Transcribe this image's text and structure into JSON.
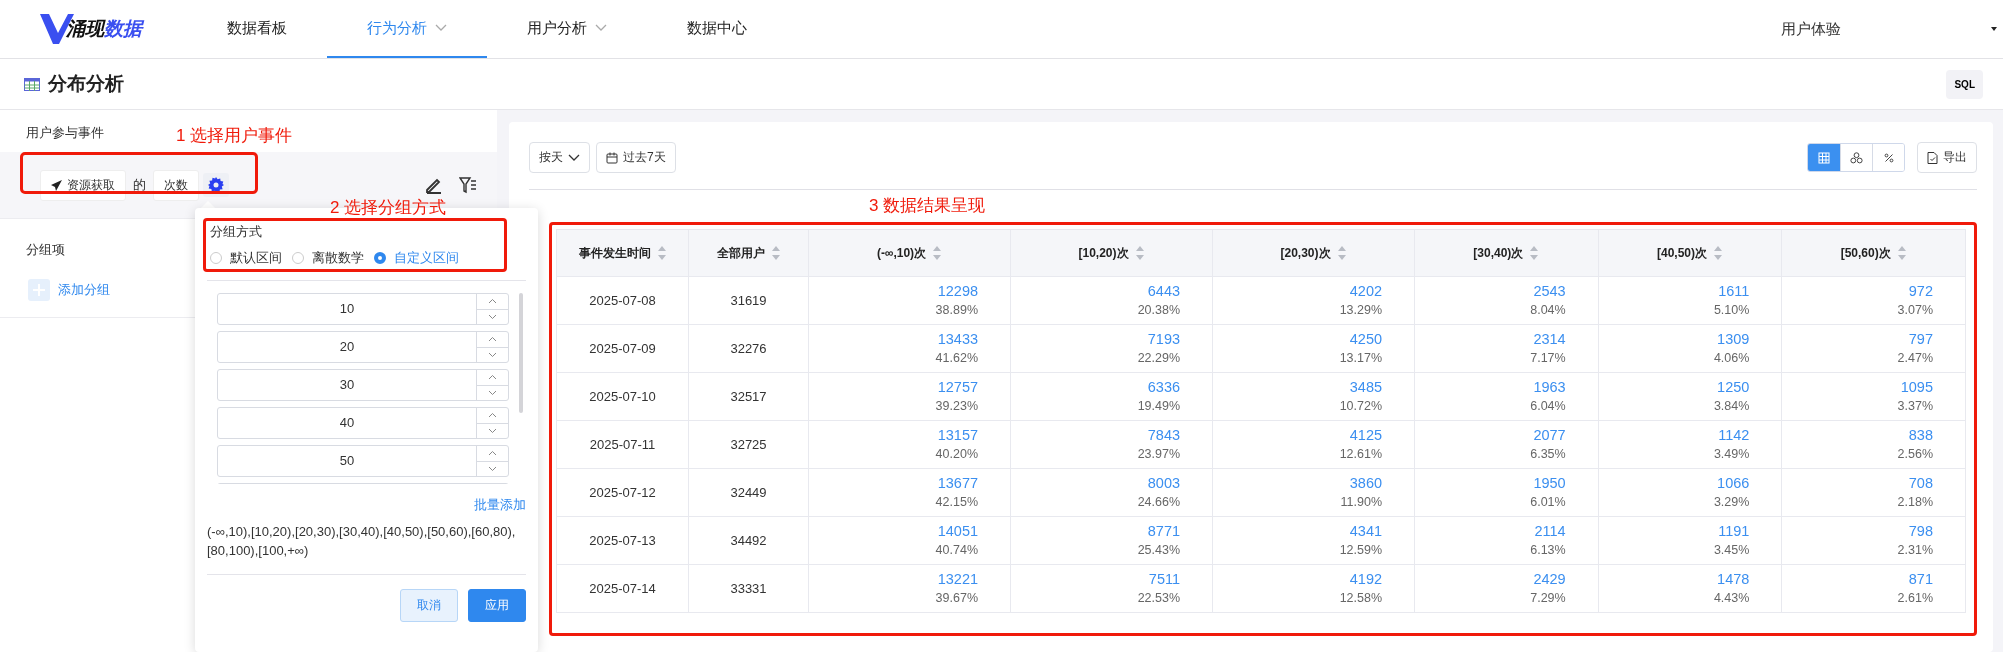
{
  "logo": {
    "parts": [
      "涌现",
      "数据"
    ]
  },
  "nav": [
    {
      "label": "数据看板",
      "selected": false,
      "dropdown": false
    },
    {
      "label": "行为分析",
      "selected": true,
      "dropdown": true
    },
    {
      "label": "用户分析",
      "selected": false,
      "dropdown": true
    },
    {
      "label": "数据中心",
      "selected": false,
      "dropdown": false
    }
  ],
  "user_menu": "用户体验",
  "page_title": "分布分析",
  "sql_button": "SQL",
  "left_panel": {
    "event_label": "用户参与事件",
    "event": {
      "name": "资源获取",
      "connector": "的",
      "metric": "次数"
    },
    "group_label": "分组项",
    "add_group": "添加分组"
  },
  "popover": {
    "title": "分组方式",
    "options": [
      {
        "label": "默认区间",
        "selected": false
      },
      {
        "label": "离散数学",
        "selected": false
      },
      {
        "label": "自定义区间",
        "selected": true
      }
    ],
    "inputs": [
      "10",
      "20",
      "30",
      "40",
      "50"
    ],
    "batch_add": "批量添加",
    "ranges": "(-∞,10),[10,20),[20,30),[30,40),[40,50),[50,60),[60,80),[80,100),[100,+∞)",
    "buttons": [
      {
        "label": "取消",
        "kind": "secondary"
      },
      {
        "label": "应用",
        "kind": "primary"
      }
    ]
  },
  "annotations": [
    "1 选择用户事件",
    "2 选择分组方式",
    "3 数据结果呈现"
  ],
  "toolbar": {
    "granularity": "按天",
    "date_range": "过去7天",
    "views": [
      {
        "kind": "table",
        "selected": true
      },
      {
        "kind": "chart",
        "selected": false
      },
      {
        "kind": "percent",
        "selected": false
      }
    ],
    "export": "导出"
  },
  "table": {
    "columns": [
      "事件发生时间",
      "全部用户",
      "(-∞,10)次",
      "[10,20)次",
      "[20,30)次",
      "[30,40)次",
      "[40,50)次",
      "[50,60)次"
    ],
    "rows": [
      [
        {
          "value": "2025-07-08"
        },
        {
          "value": "31619"
        },
        {
          "value": "12298",
          "share": "38.89%"
        },
        {
          "value": "6443",
          "share": "20.38%"
        },
        {
          "value": "4202",
          "share": "13.29%"
        },
        {
          "value": "2543",
          "share": "8.04%"
        },
        {
          "value": "1611",
          "share": "5.10%"
        },
        {
          "value": "972",
          "share": "3.07%"
        }
      ],
      [
        {
          "value": "2025-07-09"
        },
        {
          "value": "32276"
        },
        {
          "value": "13433",
          "share": "41.62%"
        },
        {
          "value": "7193",
          "share": "22.29%"
        },
        {
          "value": "4250",
          "share": "13.17%"
        },
        {
          "value": "2314",
          "share": "7.17%"
        },
        {
          "value": "1309",
          "share": "4.06%"
        },
        {
          "value": "797",
          "share": "2.47%"
        }
      ],
      [
        {
          "value": "2025-07-10"
        },
        {
          "value": "32517"
        },
        {
          "value": "12757",
          "share": "39.23%"
        },
        {
          "value": "6336",
          "share": "19.49%"
        },
        {
          "value": "3485",
          "share": "10.72%"
        },
        {
          "value": "1963",
          "share": "6.04%"
        },
        {
          "value": "1250",
          "share": "3.84%"
        },
        {
          "value": "1095",
          "share": "3.37%"
        }
      ],
      [
        {
          "value": "2025-07-11"
        },
        {
          "value": "32725"
        },
        {
          "value": "13157",
          "share": "40.20%"
        },
        {
          "value": "7843",
          "share": "23.97%"
        },
        {
          "value": "4125",
          "share": "12.61%"
        },
        {
          "value": "2077",
          "share": "6.35%"
        },
        {
          "value": "1142",
          "share": "3.49%"
        },
        {
          "value": "838",
          "share": "2.56%"
        }
      ],
      [
        {
          "value": "2025-07-12"
        },
        {
          "value": "32449"
        },
        {
          "value": "13677",
          "share": "42.15%"
        },
        {
          "value": "8003",
          "share": "24.66%"
        },
        {
          "value": "3860",
          "share": "11.90%"
        },
        {
          "value": "1950",
          "share": "6.01%"
        },
        {
          "value": "1066",
          "share": "3.29%"
        },
        {
          "value": "708",
          "share": "2.18%"
        }
      ],
      [
        {
          "value": "2025-07-13"
        },
        {
          "value": "34492"
        },
        {
          "value": "14051",
          "share": "40.74%"
        },
        {
          "value": "8771",
          "share": "25.43%"
        },
        {
          "value": "4341",
          "share": "12.59%"
        },
        {
          "value": "2114",
          "share": "6.13%"
        },
        {
          "value": "1191",
          "share": "3.45%"
        },
        {
          "value": "798",
          "share": "2.31%"
        }
      ],
      [
        {
          "value": "2025-07-14"
        },
        {
          "value": "33331"
        },
        {
          "value": "13221",
          "share": "39.67%"
        },
        {
          "value": "7511",
          "share": "22.53%"
        },
        {
          "value": "4192",
          "share": "12.58%"
        },
        {
          "value": "2429",
          "share": "7.29%"
        },
        {
          "value": "1478",
          "share": "4.43%"
        },
        {
          "value": "871",
          "share": "2.61%"
        }
      ]
    ]
  }
}
